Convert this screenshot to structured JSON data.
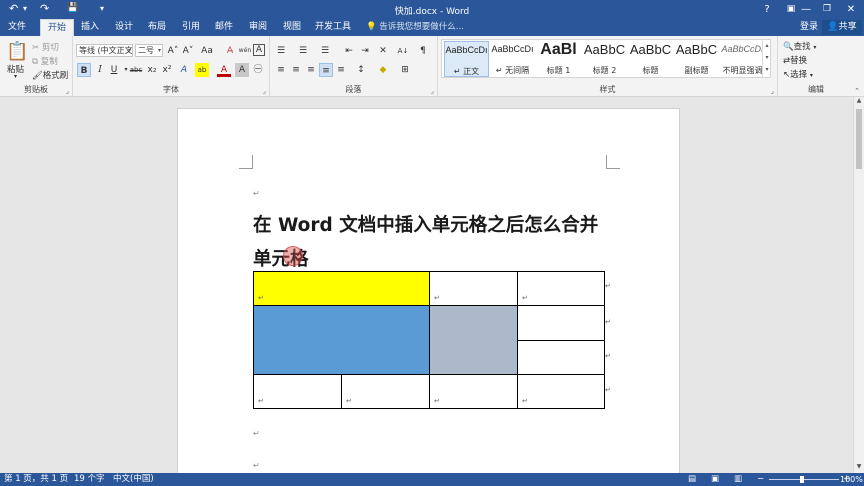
{
  "window": {
    "title": "快加.docx - Word",
    "quick_access": {
      "undo": "↶",
      "redo": "↷",
      "save": "💾",
      "customize": "▾"
    },
    "controls": {
      "help": "?",
      "ribbon_display": "▣",
      "minimize": "—",
      "maximize": "❐",
      "close": "✕"
    }
  },
  "tabs": [
    "文件",
    "开始",
    "插入",
    "设计",
    "布局",
    "引用",
    "邮件",
    "审阅",
    "视图",
    "开发工具"
  ],
  "active_tab": "开始",
  "tell_me": "告诉我您想要做什么...",
  "tell_me_icon": "lightbulb-icon",
  "account": {
    "login": "登录",
    "share": "共享"
  },
  "ribbon": {
    "clipboard": {
      "label": "剪贴板",
      "paste": "粘贴",
      "cut": "剪切",
      "copy": "复制",
      "format_painter": "格式刷"
    },
    "font": {
      "label": "字体",
      "font_name": "等线 (中文正文)",
      "font_size": "二号",
      "grow": "A˄",
      "shrink": "A˅",
      "change_case": "Aa",
      "clear_format": "A̶",
      "phonetic": "wén",
      "char_border": "A",
      "bold": "B",
      "italic": "I",
      "underline": "U",
      "strike": "abc",
      "subscript": "x₂",
      "superscript": "x²",
      "text_effects": "A",
      "highlight": "ab",
      "font_color": "A",
      "char_shading": "A",
      "enclose": "㊀"
    },
    "paragraph": {
      "label": "段落",
      "bullets": "☰",
      "numbering": "☰",
      "multilevel": "☰",
      "decrease_indent": "⇤",
      "increase_indent": "⇥",
      "chinese_layout": "✕",
      "sort": "A↓",
      "show_marks": "¶",
      "align_left": "≡",
      "center": "≡",
      "align_right": "≡",
      "justify": "≡",
      "distributed": "≡",
      "line_spacing": "↕",
      "shading": "◆",
      "borders": "⊞"
    },
    "styles": {
      "label": "样式",
      "items": [
        {
          "preview": "AaBbCcDı",
          "name": "↵ 正文"
        },
        {
          "preview": "AaBbCcDı",
          "name": "↵ 无间隔"
        },
        {
          "preview": "AaBl",
          "name": "标题 1"
        },
        {
          "preview": "AaBbC",
          "name": "标题 2"
        },
        {
          "preview": "AaBbC",
          "name": "标题"
        },
        {
          "preview": "AaBbC",
          "name": "副标题"
        },
        {
          "preview": "AaBbCcDı",
          "name": "不明显强调"
        }
      ]
    },
    "editing": {
      "label": "编辑",
      "find": "查找",
      "replace": "替换",
      "select": "选择"
    }
  },
  "document": {
    "heading": "在 Word 文档中插入单元格之后怎么合并单元格",
    "paragraph_mark": "↵",
    "cursor": "I",
    "colors": {
      "yellow": "#ffff00",
      "blue": "#5b9bd5",
      "gray": "#acb9ca"
    }
  },
  "status": {
    "page": "第 1 页，共 1 页",
    "words": "19 个字",
    "language": "中文(中国)",
    "zoom": "100%",
    "zoom_out": "−",
    "zoom_in": "+"
  }
}
